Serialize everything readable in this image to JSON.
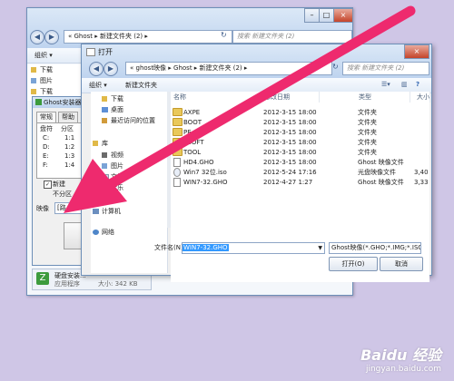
{
  "explorer": {
    "address": "« Ghost ▸ 新建文件夹 (2) ▸",
    "search_placeholder": "搜索 新建文件夹 (2)",
    "organize": "组织 ▾",
    "open": "打开",
    "sidebar": [
      "下载",
      "图片",
      "下载"
    ],
    "taskbar_title": "硬盘安装...",
    "taskbar_sub": "应用程序",
    "taskbar_size": "大小: 342 KB"
  },
  "ghost_dialog": {
    "title": "Ghost安装器",
    "tabs": [
      "常规",
      "帮助"
    ],
    "table_headers": [
      "盘符",
      "分区"
    ],
    "table_rows": [
      [
        "C:",
        "1:1"
      ],
      [
        "D:",
        "1:2"
      ],
      [
        "E:",
        "1:3"
      ],
      [
        "F:",
        "1:4"
      ]
    ],
    "check_label": "新建",
    "no_partition": "不分区",
    "image_label": "映像",
    "image_value": "[路"
  },
  "open_dialog": {
    "breadcrumb": "« ghost映像 ▸ Ghost ▸ 新建文件夹 (2) ▸",
    "search_placeholder": "搜索 新建文件夹 (2)",
    "organize": "组织 ▾",
    "new_folder": "新建文件夹",
    "nav_items": [
      {
        "label": "下载",
        "icon": "download-icon"
      },
      {
        "label": "桌面",
        "icon": "desktop-icon"
      },
      {
        "label": "最近访问的位置",
        "icon": "recent-icon"
      },
      {
        "label": "库",
        "icon": "library-icon"
      },
      {
        "label": "视频",
        "icon": "video-icon"
      },
      {
        "label": "图片",
        "icon": "picture-icon"
      },
      {
        "label": "文档",
        "icon": "document-icon"
      },
      {
        "label": "音乐",
        "icon": "music-icon"
      },
      {
        "label": "计算机",
        "icon": "computer-icon"
      },
      {
        "label": "网络",
        "icon": "network-icon"
      }
    ],
    "columns": [
      "名称",
      "修改日期",
      "类型",
      "大小"
    ],
    "files": [
      {
        "name": "AXPE",
        "date": "2012-3-15 18:00",
        "type": "文件夹",
        "size": "",
        "kind": "folder"
      },
      {
        "name": "BOOT",
        "date": "2012-3-15 18:00",
        "type": "文件夹",
        "size": "",
        "kind": "folder"
      },
      {
        "name": "PE",
        "date": "2012-3-15 18:00",
        "type": "文件夹",
        "size": "",
        "kind": "folder"
      },
      {
        "name": "ESOFT",
        "date": "2012-3-15 18:00",
        "type": "文件夹",
        "size": "",
        "kind": "folder"
      },
      {
        "name": "TOOL",
        "date": "2012-3-15 18:00",
        "type": "文件夹",
        "size": "",
        "kind": "folder"
      },
      {
        "name": "HD4.GHO",
        "date": "2012-3-15 18:00",
        "type": "Ghost 映像文件",
        "size": "",
        "kind": "file"
      },
      {
        "name": "Win7 32位.iso",
        "date": "2012-5-24 17:16",
        "type": "光盘映像文件",
        "size": "3,40",
        "kind": "file"
      },
      {
        "name": "WIN7-32.GHO",
        "date": "2012-4-27 1:27",
        "type": "Ghost 映像文件",
        "size": "3,33",
        "kind": "file"
      }
    ],
    "filename_label": "文件名(N):",
    "filename_value": "WIN7-32.GHO",
    "filetype_value": "Ghost映像(*.GHO;*.IMG;*.ISO",
    "open_button": "打开(O)",
    "cancel_button": "取消"
  },
  "watermark": {
    "brand": "Baidu 经验",
    "url": "jingyan.baidu.com"
  },
  "colors": {
    "arrow": "#ee2a6e",
    "background": "#cfc6e6",
    "selection": "#3399ff"
  }
}
